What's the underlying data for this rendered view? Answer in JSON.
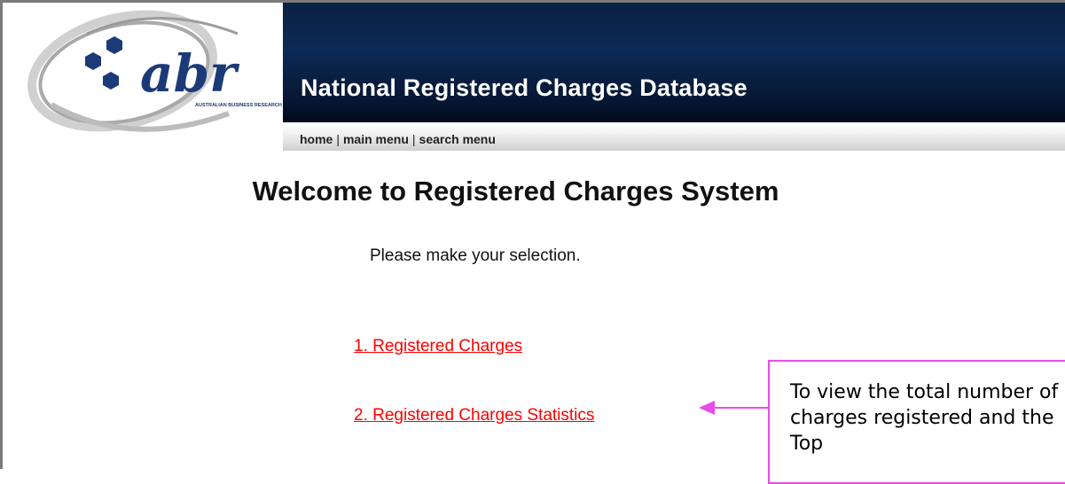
{
  "header": {
    "logo_text": "abr",
    "logo_subtext": "AUSTRALIAN BUSINESS RESEARCH",
    "title": "National Registered Charges Database"
  },
  "nav": {
    "home": "home",
    "main_menu": "main menu",
    "search_menu": "search menu",
    "separator": "|"
  },
  "main": {
    "heading": "Welcome to Registered Charges System",
    "prompt": "Please make your selection.",
    "links": [
      {
        "label": "1. Registered Charges"
      },
      {
        "label": "2. Registered Charges Statistics"
      }
    ]
  },
  "annotation": {
    "text": "To view the total number of charges registered and the Top",
    "border_color": "#e84ce8"
  },
  "colors": {
    "header_bg": "#0b2a55",
    "link": "#ff0000"
  }
}
